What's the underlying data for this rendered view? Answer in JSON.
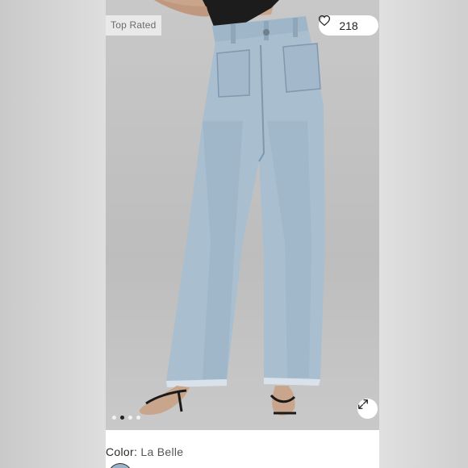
{
  "product": {
    "badge_label": "Top Rated",
    "like_count": "218",
    "like_icon": "heart-outline-icon",
    "expand_icon": "expand-arrows-icon",
    "carousel": {
      "total": 4,
      "active_index": 1
    },
    "color_label": "Color:",
    "color_value": "La Belle",
    "swatch_color": "#9bb3c8"
  },
  "colors": {
    "denim": "#a9bfd0",
    "denim_shade": "#8ea6ba",
    "background": "#c4c4c4"
  }
}
